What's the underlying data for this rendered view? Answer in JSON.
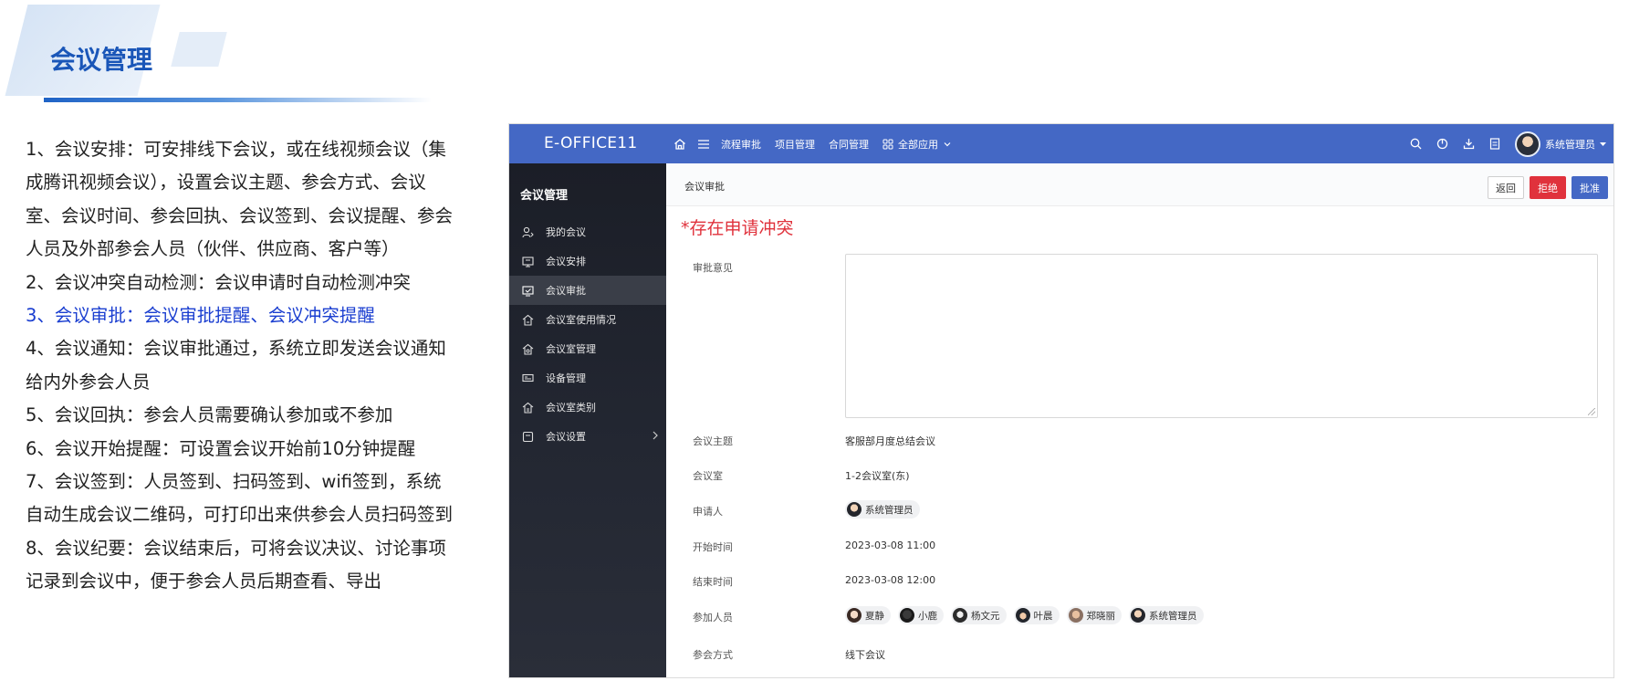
{
  "slide": {
    "title": "会议管理",
    "points": [
      "1、会议安排：可安排线下会议，或在线视频会议（集成腾讯视频会议），设置会议主题、参会方式、会议室、会议时间、参会回执、会议签到、会议提醒、参会人员及外部参会人员（伙伴、供应商、客户等）",
      "2、会议冲突自动检测：会议申请时自动检测冲突",
      "3、会议审批：会议审批提醒、会议冲突提醒",
      "4、会议通知：会议审批通过，系统立即发送会议通知给内外参会人员",
      "5、会议回执：参会人员需要确认参加或不参加",
      "6、会议开始提醒：可设置会议开始前10分钟提醒",
      "7、会议签到：人员签到、扫码签到、wifi签到，系统自动生成会议二维码，可打印出来供参会人员扫码签到",
      "8、会议纪要：会议结束后，可将会议决议、讨论事项记录到会议中，便于参会人员后期查看、导出"
    ]
  },
  "app": {
    "brand": "E-OFFICE11",
    "nav": {
      "home_icon": "home-icon",
      "menu_icon": "hamburger-icon",
      "links": [
        "流程审批",
        "项目管理",
        "合同管理"
      ],
      "all_apps": "全部应用"
    },
    "user_name": "系统管理员",
    "sidebar": {
      "heading": "会议管理",
      "items": [
        {
          "label": "我的会议",
          "icon": "user-meeting-icon"
        },
        {
          "label": "会议安排",
          "icon": "calendar-icon"
        },
        {
          "label": "会议审批",
          "icon": "approval-icon"
        },
        {
          "label": "会议室使用情况",
          "icon": "room-usage-icon"
        },
        {
          "label": "会议室管理",
          "icon": "room-manage-icon"
        },
        {
          "label": "设备管理",
          "icon": "device-icon"
        },
        {
          "label": "会议室类别",
          "icon": "room-category-icon"
        },
        {
          "label": "会议设置",
          "icon": "settings-icon"
        }
      ]
    },
    "page": {
      "breadcrumb": "会议审批",
      "buttons": {
        "back": "返回",
        "reject": "拒绝",
        "approve": "批准"
      },
      "conflict_notice": "*存在申请冲突",
      "fields": {
        "opinion_label": "审批意见",
        "opinion_value": "",
        "subject_label": "会议主题",
        "subject_value": "客服部月度总结会议",
        "room_label": "会议室",
        "room_value": "1-2会议室(东)",
        "applicant_label": "申请人",
        "applicant_value": "系统管理员",
        "start_label": "开始时间",
        "start_value": "2023-03-08 11:00",
        "end_label": "结束时间",
        "end_value": "2023-03-08 12:00",
        "attendees_label": "参加人员",
        "attendees": [
          "夏静",
          "小鹿",
          "杨文元",
          "叶晨",
          "郑晓丽",
          "系统管理员"
        ],
        "mode_label": "参会方式",
        "mode_value": "线下会议"
      }
    }
  },
  "colors": {
    "title_blue": "#1a56b8",
    "highlight_blue": "#1a3ed0",
    "topbar": "#4468c5",
    "sidebar": "#1b1e27",
    "danger": "#e0323c"
  }
}
